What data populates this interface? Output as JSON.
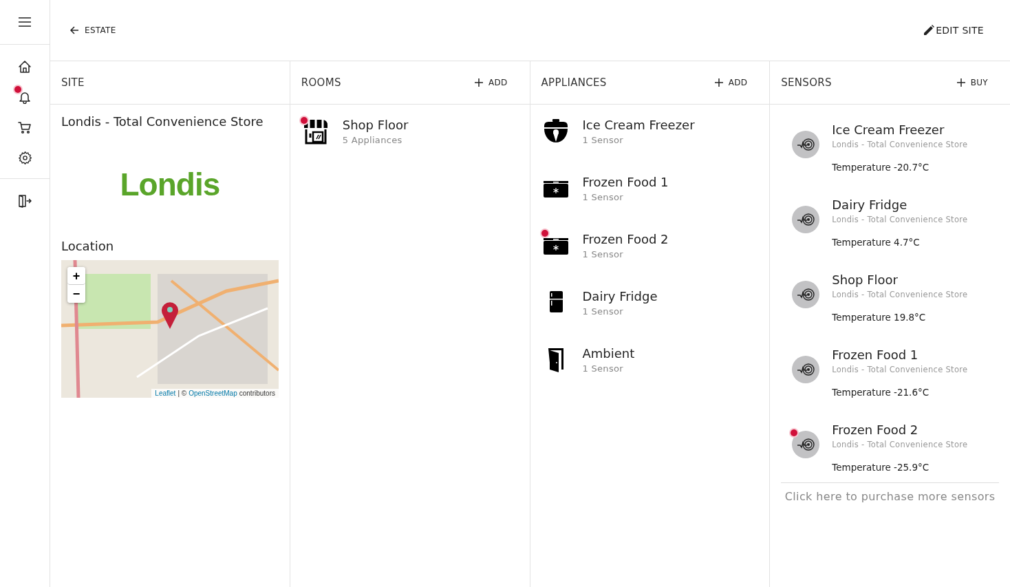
{
  "nav": {
    "items": [
      {
        "kind": "home",
        "alert": false
      },
      {
        "kind": "bell",
        "alert": true
      },
      {
        "kind": "cart",
        "alert": false
      },
      {
        "kind": "gear",
        "alert": false
      }
    ],
    "footer": {
      "kind": "exit"
    }
  },
  "header": {
    "back": "ESTATE",
    "edit": "EDIT SITE"
  },
  "site": {
    "heading": "SITE",
    "name": "Londis - Total Convenience Store",
    "logo": "Londis",
    "location_title": "Location",
    "map": {
      "zoom_in": "+",
      "zoom_out": "−",
      "attribution_link_1": "Leaflet",
      "attribution_sep": "| ©",
      "attribution_link_2": "OpenStreetMap",
      "attribution_tail": "contributors"
    }
  },
  "rooms": {
    "heading": "ROOMS",
    "action": "ADD",
    "items": [
      {
        "name": "Shop Floor",
        "detail": "5 Appliances",
        "alert": true
      }
    ]
  },
  "appliances": {
    "heading": "APPLIANCES",
    "action": "ADD",
    "items": [
      {
        "kind": "ice-cream",
        "name": "Ice Cream Freezer",
        "detail": "1 Sensor",
        "alert": false
      },
      {
        "kind": "chest",
        "name": "Frozen Food 1",
        "detail": "1 Sensor",
        "alert": false
      },
      {
        "kind": "chest",
        "name": "Frozen Food 2",
        "detail": "1 Sensor",
        "alert": true
      },
      {
        "kind": "fridge",
        "name": "Dairy Fridge",
        "detail": "1 Sensor",
        "alert": false
      },
      {
        "kind": "door",
        "name": "Ambient",
        "detail": "1 Sensor",
        "alert": false
      }
    ]
  },
  "sensors": {
    "heading": "SENSORS",
    "action": "BUY",
    "items": [
      {
        "name": "Ice Cream Freezer",
        "site": "Londis - Total Convenience Store",
        "reading": "Temperature -20.7°C",
        "alert": false
      },
      {
        "name": "Dairy Fridge",
        "site": "Londis - Total Convenience Store",
        "reading": "Temperature 4.7°C",
        "alert": false
      },
      {
        "name": "Shop Floor",
        "site": "Londis - Total Convenience Store",
        "reading": "Temperature 19.8°C",
        "alert": false
      },
      {
        "name": "Frozen Food 1",
        "site": "Londis - Total Convenience Store",
        "reading": "Temperature -21.6°C",
        "alert": false
      },
      {
        "name": "Frozen Food 2",
        "site": "Londis - Total Convenience Store",
        "reading": "Temperature -25.9°C",
        "alert": true
      }
    ],
    "purchase_link": "Click here to purchase more sensors"
  }
}
